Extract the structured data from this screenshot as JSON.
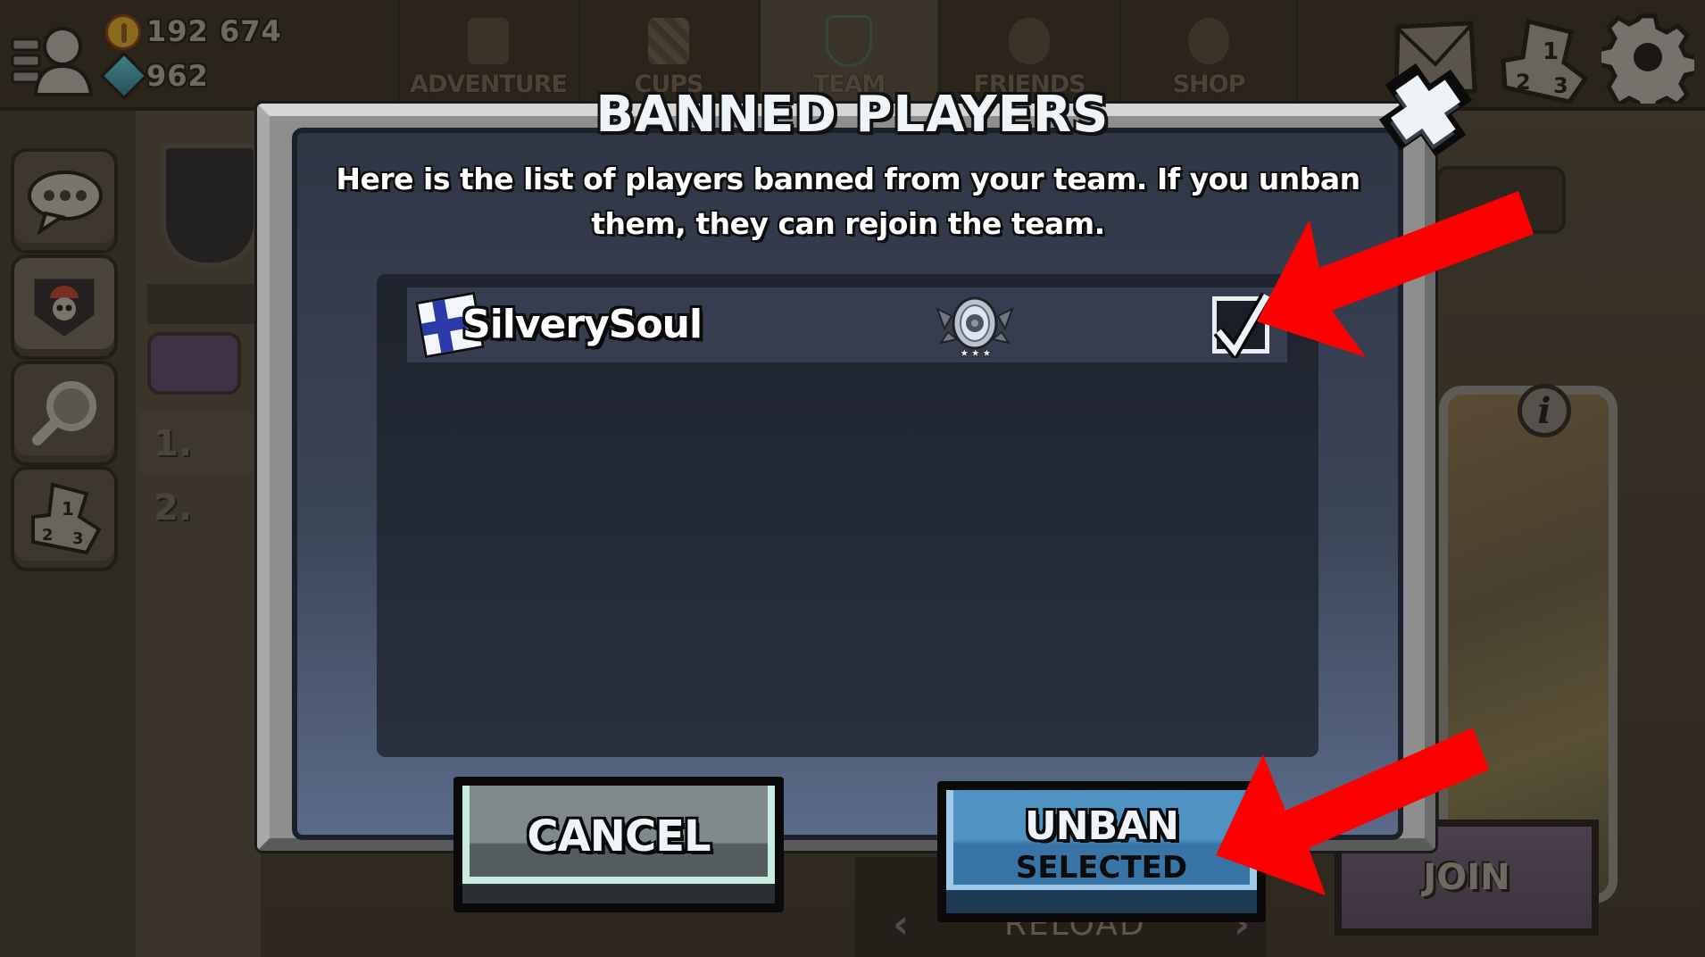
{
  "topbar": {
    "coins": "192 674",
    "gems": "962",
    "tabs": [
      {
        "label": "ADVENTURE",
        "icon": "fuel-can-icon"
      },
      {
        "label": "CUPS",
        "icon": "checkered-flag-icon"
      },
      {
        "label": "TEAM",
        "icon": "team-shield-icon"
      },
      {
        "label": "FRIENDS",
        "icon": "friends-icon"
      },
      {
        "label": "SHOP",
        "icon": "coin-stack-icon"
      }
    ],
    "active_tab": "TEAM",
    "right_icons": [
      "mail-icon",
      "leaderboard-podium-icon",
      "settings-gear-icon"
    ]
  },
  "sidebar": {
    "items": [
      {
        "name": "chat",
        "icon": "chat-bubble-icon"
      },
      {
        "name": "my-team",
        "icon": "team-emblem-icon",
        "active": true
      },
      {
        "name": "search",
        "icon": "magnifier-icon"
      },
      {
        "name": "rankings",
        "icon": "podium-icon"
      }
    ]
  },
  "background": {
    "rank_rows": [
      "1.",
      "2."
    ],
    "reload_label": "RELOAD",
    "join_label": "JOIN"
  },
  "dialog": {
    "title": "BANNED PLAYERS",
    "description": "Here is the list of players banned from your team. If you unban them, they can rejoin the team.",
    "players": [
      {
        "name": "SilverySoul",
        "country_flag": "Finland",
        "rank_badge": "silver-rank-3-stars",
        "selected": true
      }
    ],
    "cancel_label": "CANCEL",
    "unban_label_line1": "UNBAN",
    "unban_label_line2": "SELECTED"
  },
  "colors": {
    "annotation_arrow": "#ff0000",
    "unban_button": "#4f93c3",
    "cancel_button": "#7f8b8a"
  }
}
